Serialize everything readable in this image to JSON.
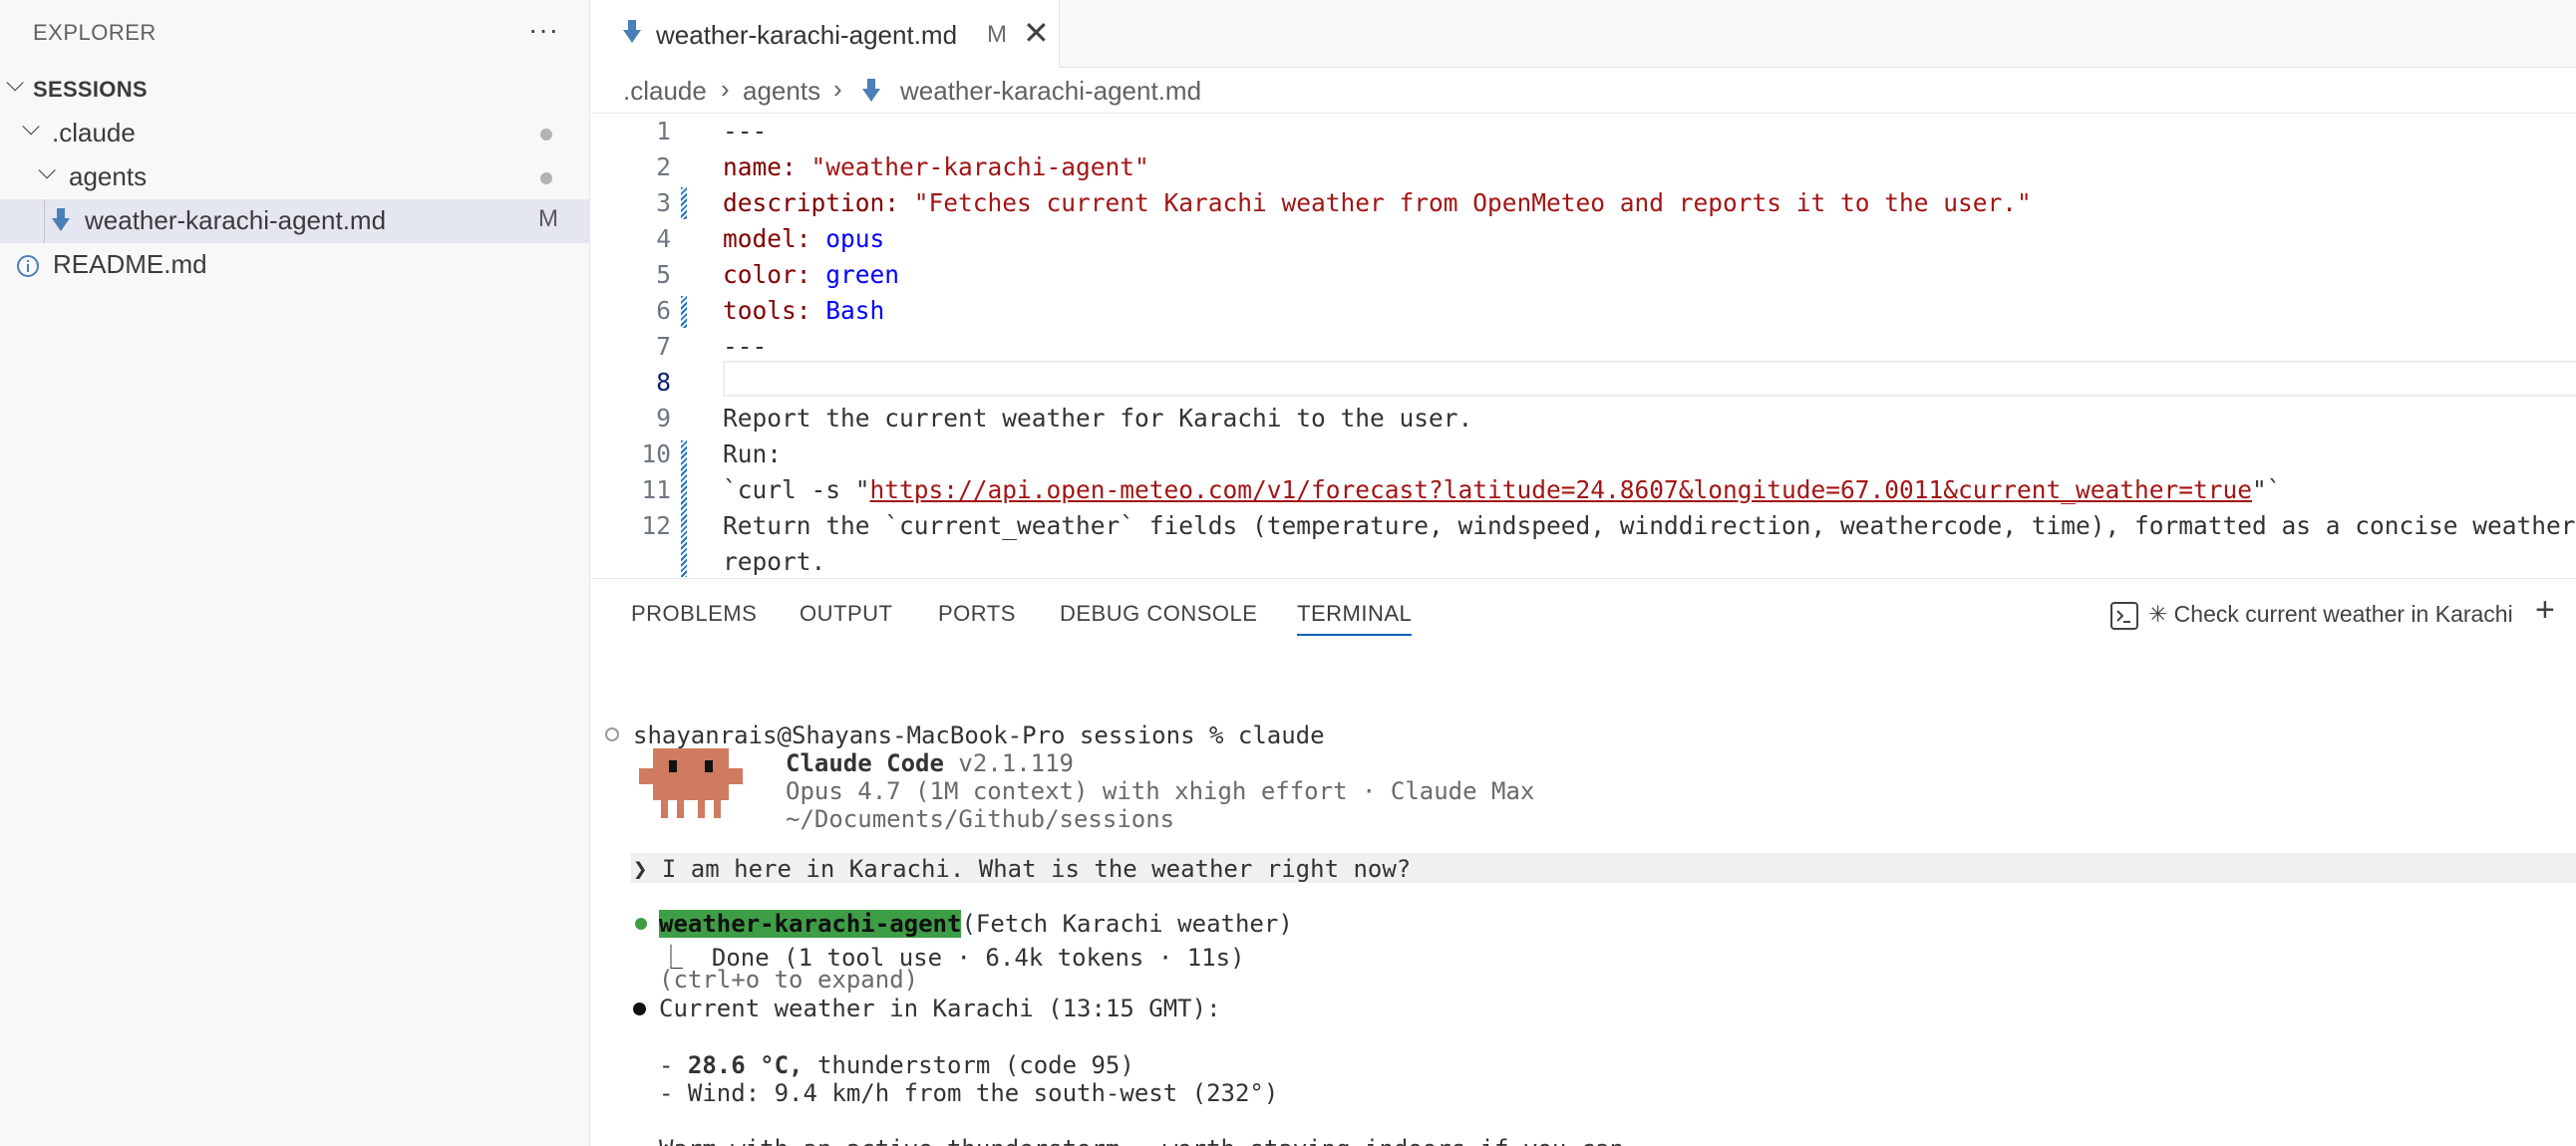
{
  "sidebar": {
    "title": "EXPLORER",
    "more": "···",
    "root": {
      "label": "SESSIONS"
    },
    "items": [
      {
        "label": ".claude"
      },
      {
        "label": "agents"
      },
      {
        "label": "weather-karachi-agent.md",
        "status": "M"
      },
      {
        "label": "README.md"
      }
    ]
  },
  "tab": {
    "label": "weather-karachi-agent.md",
    "status": "M",
    "close": "✕"
  },
  "breadcrumb": [
    ".claude",
    "agents",
    "weather-karachi-agent.md"
  ],
  "editor": {
    "line_numbers": [
      "1",
      "2",
      "3",
      "4",
      "5",
      "6",
      "7",
      "8",
      "9",
      "10",
      "11",
      "12"
    ],
    "l1": "---",
    "l2_key": "name:",
    "l2_val": "\"weather-karachi-agent\"",
    "l3_key": "description:",
    "l3_val": "\"Fetches current Karachi weather from OpenMeteo and reports it to the user.\"",
    "l4_key": "model:",
    "l4_val": "opus",
    "l5_key": "color:",
    "l5_val": "green",
    "l6_key": "tools:",
    "l6_val": "Bash",
    "l7": "---",
    "l9": "Report the current weather for Karachi to the user.",
    "l10": "Run:",
    "l11_pre": "`curl -s \"",
    "l11_url": "https://api.open-meteo.com/v1/forecast?latitude=24.8607&longitude=67.0011&current_weather=true",
    "l11_post": "\"`",
    "l12a": "Return the `current_weather` fields (temperature, windspeed, winddirection, weathercode, time), formatted as a concise weather",
    "l12b": "report."
  },
  "panel": {
    "tabs": [
      "PROBLEMS",
      "OUTPUT",
      "PORTS",
      "DEBUG CONSOLE",
      "TERMINAL"
    ],
    "active_tab": "TERMINAL",
    "terminal_title": "✳ Check current weather in Karachi",
    "add": "+"
  },
  "terminal": {
    "prompt_line": "shayanrais@Shayans-MacBook-Pro sessions % claude",
    "app_name": "Claude Code",
    "app_version": "v2.1.119",
    "model_line": "Opus 4.7 (1M context) with xhigh effort · Claude Max",
    "cwd": "~/Documents/Github/sessions",
    "user_prompt": "❯ I am here in Karachi. What is the weather right now?",
    "agent_name": "weather-karachi-agent",
    "agent_task": "(Fetch Karachi weather)",
    "agent_done": "⎿  Done (1 tool use · 6.4k tokens · 11s)",
    "expand_hint": "(ctrl+o to expand)",
    "result_heading": "Current weather in Karachi (13:15 GMT):",
    "temp_bold": "28.6 °C,",
    "temp_rest": " thunderstorm (code 95)",
    "wind_line": "- Wind: 9.4 km/h from the south-west (232°)",
    "summary": "Warm with an active thunderstorm — worth staying indoors if you can."
  },
  "colors": {
    "accent": "#005fb8",
    "agent_green": "#3e9e46",
    "crab": "#d07a5f",
    "yaml_key": "#800000",
    "yaml_string": "#a31515",
    "yaml_value": "#0000ff"
  }
}
